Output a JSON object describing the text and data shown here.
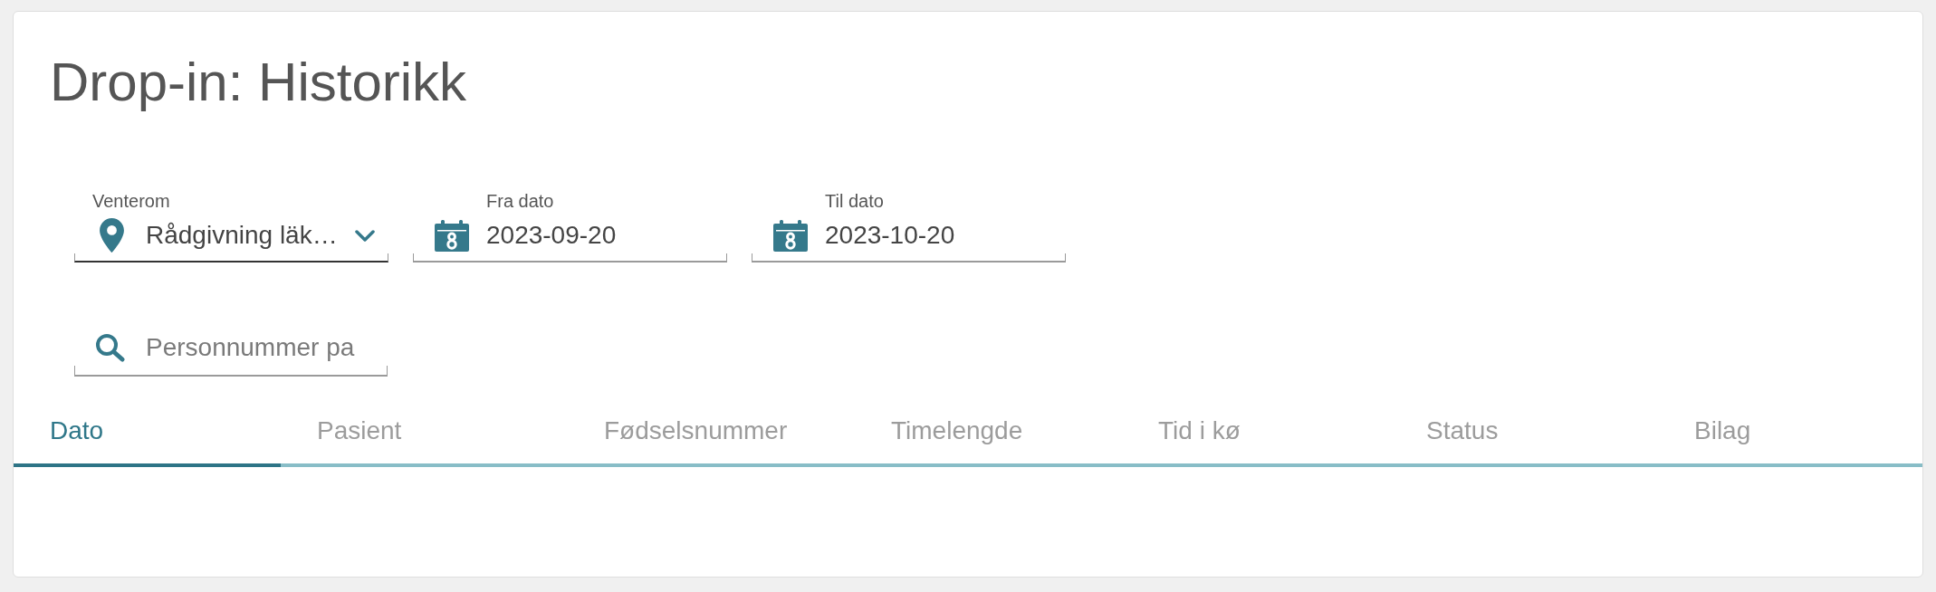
{
  "page": {
    "title": "Drop-in: Historikk"
  },
  "filters": [
    {
      "kind": "select",
      "label": "Venterom",
      "value": "Rådgivning läk…"
    },
    {
      "kind": "date",
      "label": "Fra dato",
      "value": "2023-09-20"
    },
    {
      "kind": "date",
      "label": "Til dato",
      "value": "2023-10-20"
    }
  ],
  "search": {
    "placeholder": "Personnummer pa"
  },
  "table": {
    "columns": [
      {
        "label": "Dato",
        "selected": true
      },
      {
        "label": "Pasient",
        "selected": false
      },
      {
        "label": "Fødselsnummer",
        "selected": false
      },
      {
        "label": "Timelengde",
        "selected": false
      },
      {
        "label": "Tid i kø",
        "selected": false
      },
      {
        "label": "Status",
        "selected": false
      },
      {
        "label": "Bilag",
        "selected": false
      }
    ]
  }
}
